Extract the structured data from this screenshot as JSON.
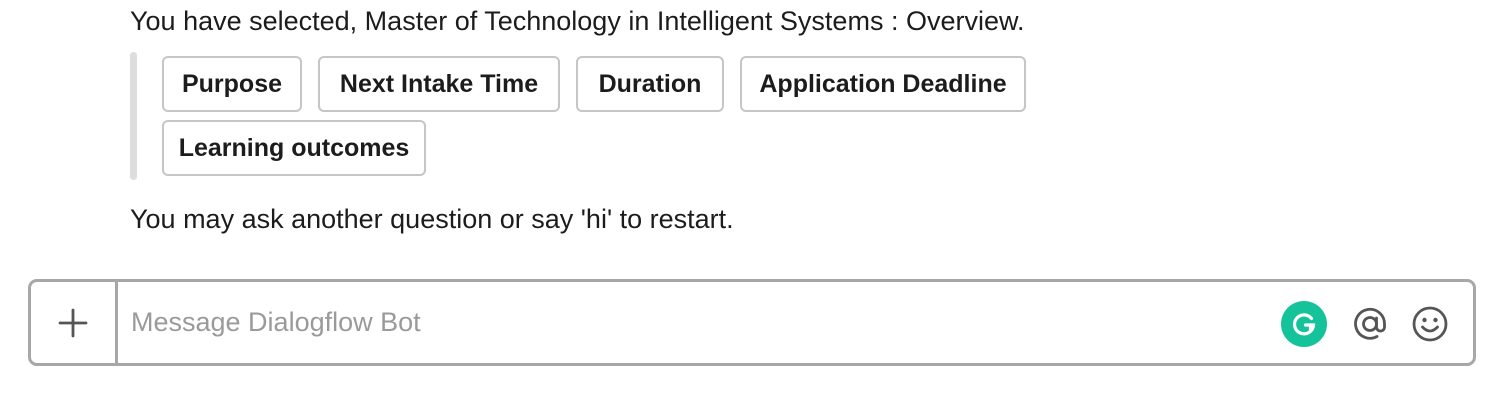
{
  "messages": {
    "selected_text": "You have selected, Master of Technology in Intelligent Systems : Overview.",
    "followup_text": "You may ask another question or say 'hi' to restart."
  },
  "quick_replies": [
    "Purpose",
    "Next Intake Time",
    "Duration",
    "Application Deadline",
    "Learning outcomes"
  ],
  "composer": {
    "placeholder": "Message Dialogflow Bot"
  },
  "icons": {
    "attach": "plus-icon",
    "grammarly": "grammarly-icon",
    "mention": "at-sign-icon",
    "emoji": "smiley-icon"
  },
  "colors": {
    "grammarly_green": "#15c39a",
    "attachment_bar": "#dddddd",
    "border": "#a7a7a7"
  }
}
